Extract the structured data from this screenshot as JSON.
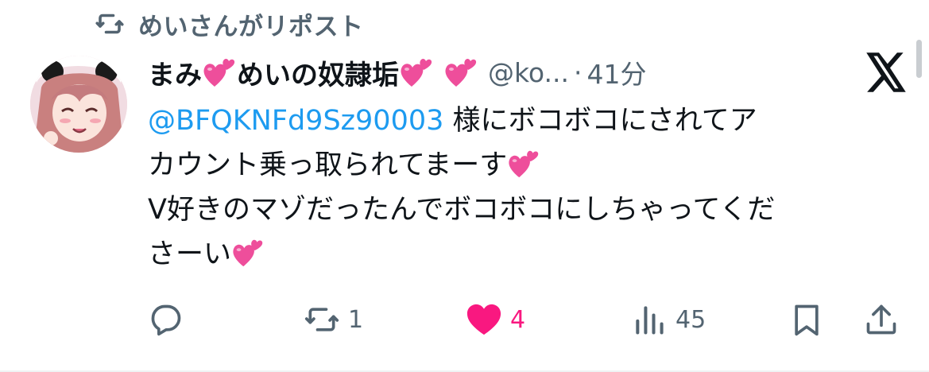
{
  "repost": {
    "text": "めいさんがリポスト",
    "icon": "repost-icon"
  },
  "tweet": {
    "author": {
      "name_part1": "まみ",
      "name_part2": "めいの奴隷垢",
      "handle": "@ko...",
      "separator": "·",
      "time": "41分",
      "avatar": "avatar-image",
      "name_emoji": "two-hearts-emoji"
    },
    "platform_icon": "x-logo-icon",
    "body": {
      "mention": "@BFQKNFd9Sz90003",
      "line1": " 様にボコボコにされてア",
      "line2": "カウント乗っ取られてまーす",
      "line3": "V好きのマゾだったんでボコボコにしちゃってくだ",
      "line4": "さーい"
    },
    "actions": {
      "reply": {
        "icon": "reply-icon",
        "count": ""
      },
      "repost": {
        "icon": "repost-icon",
        "count": "1"
      },
      "like": {
        "icon": "heart-icon",
        "count": "4",
        "liked": true
      },
      "views": {
        "icon": "views-icon",
        "count": "45"
      },
      "bookmark": {
        "icon": "bookmark-icon"
      },
      "share": {
        "icon": "share-icon"
      }
    }
  },
  "colors": {
    "text": "#0f1419",
    "secondary": "#536471",
    "link": "#1d9bf0",
    "like": "#f91880",
    "heart_emoji": "#f0529a"
  }
}
